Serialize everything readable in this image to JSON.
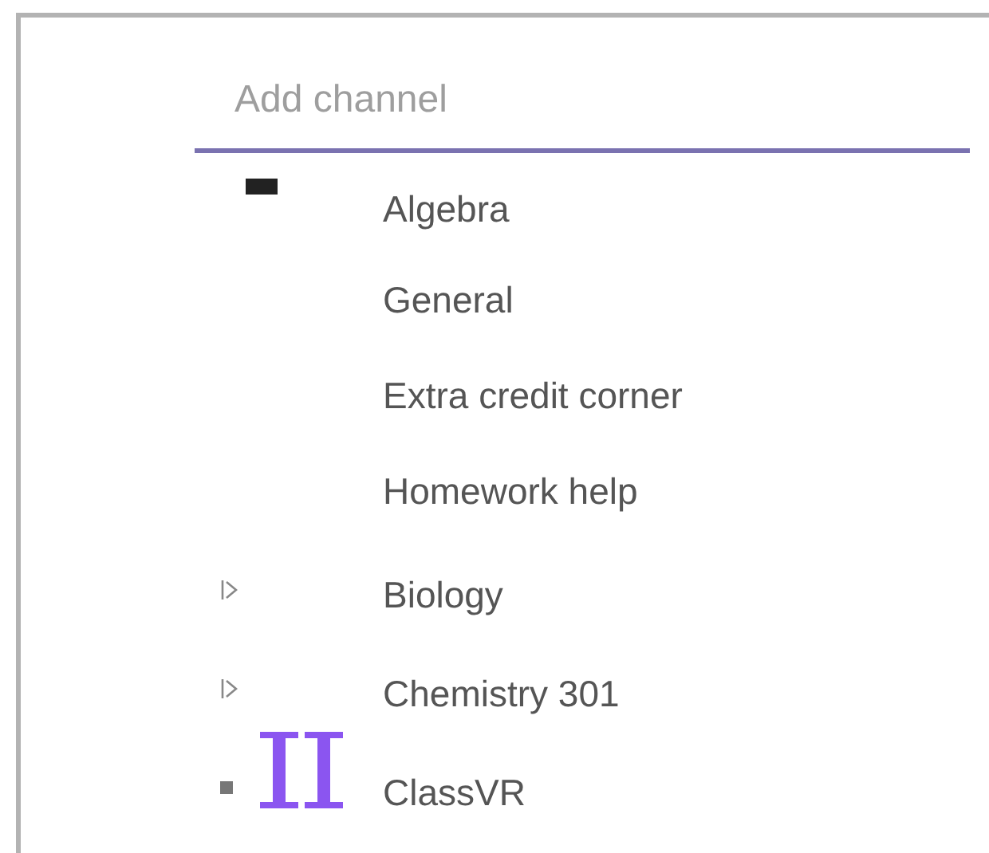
{
  "add_channel": {
    "placeholder": "Add channel"
  },
  "channels": [
    {
      "label": "Algebra",
      "kind": "group",
      "expanded": true,
      "children": [
        {
          "label": "General"
        },
        {
          "label": "Extra credit corner"
        },
        {
          "label": "Homework help"
        }
      ]
    },
    {
      "label": "Biology",
      "kind": "group",
      "expanded": false
    },
    {
      "label": "Chemistry 301",
      "kind": "group",
      "expanded": false
    },
    {
      "label": "ClassVR",
      "kind": "app"
    }
  ]
}
